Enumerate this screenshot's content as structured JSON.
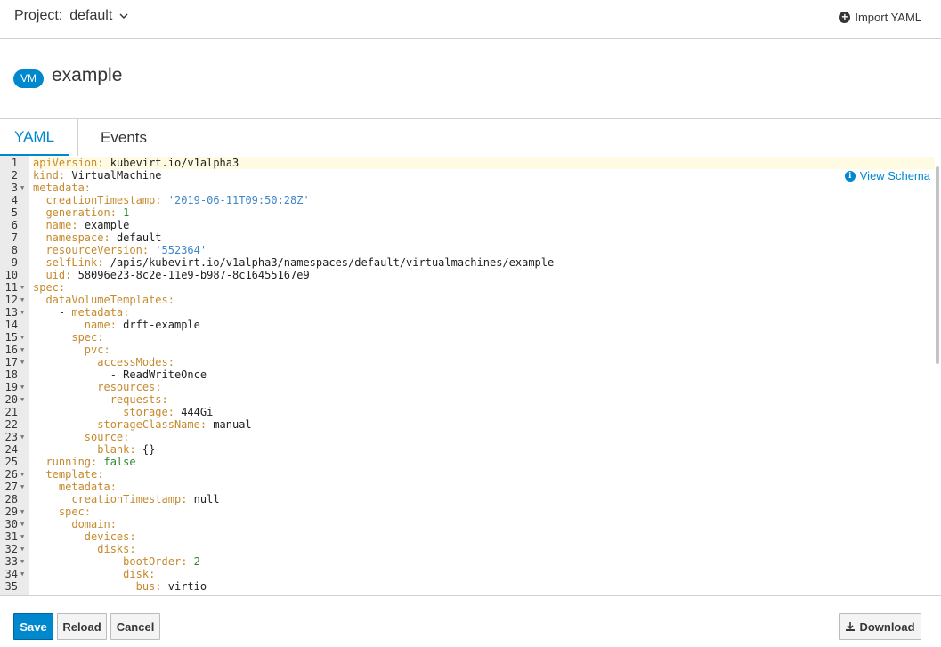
{
  "header": {
    "project_label": "Project:",
    "project_value": "default",
    "import_label": "Import YAML"
  },
  "title": {
    "badge": "VM",
    "name": "example"
  },
  "tabs": [
    {
      "label": "YAML",
      "active": true
    },
    {
      "label": "Events",
      "active": false
    }
  ],
  "editor": {
    "view_schema_label": "View Schema",
    "lines": [
      {
        "n": "1",
        "fold": false,
        "indent": 0,
        "key": "apiVersion",
        "val": "kubevirt.io/v1alpha3",
        "type": "plain"
      },
      {
        "n": "2",
        "fold": false,
        "indent": 0,
        "key": "kind",
        "val": "VirtualMachine",
        "type": "plain"
      },
      {
        "n": "3",
        "fold": true,
        "indent": 0,
        "key": "metadata",
        "val": "",
        "type": "none"
      },
      {
        "n": "4",
        "fold": false,
        "indent": 1,
        "key": "creationTimestamp",
        "val": "'2019-06-11T09:50:28Z'",
        "type": "string"
      },
      {
        "n": "5",
        "fold": false,
        "indent": 1,
        "key": "generation",
        "val": "1",
        "type": "number"
      },
      {
        "n": "6",
        "fold": false,
        "indent": 1,
        "key": "name",
        "val": "example",
        "type": "plain"
      },
      {
        "n": "7",
        "fold": false,
        "indent": 1,
        "key": "namespace",
        "val": "default",
        "type": "plain"
      },
      {
        "n": "8",
        "fold": false,
        "indent": 1,
        "key": "resourceVersion",
        "val": "'552364'",
        "type": "string"
      },
      {
        "n": "9",
        "fold": false,
        "indent": 1,
        "key": "selfLink",
        "val": "/apis/kubevirt.io/v1alpha3/namespaces/default/virtualmachines/example",
        "type": "plain"
      },
      {
        "n": "10",
        "fold": false,
        "indent": 1,
        "key": "uid",
        "val": "58096e23-8c2e-11e9-b987-8c16455167e9",
        "type": "plain"
      },
      {
        "n": "11",
        "fold": true,
        "indent": 0,
        "key": "spec",
        "val": "",
        "type": "none"
      },
      {
        "n": "12",
        "fold": true,
        "indent": 1,
        "key": "dataVolumeTemplates",
        "val": "",
        "type": "none"
      },
      {
        "n": "13",
        "fold": true,
        "indent": 2,
        "dash": true,
        "key": "metadata",
        "val": "",
        "type": "none"
      },
      {
        "n": "14",
        "fold": false,
        "indent": 4,
        "key": "name",
        "val": "drft-example",
        "type": "plain"
      },
      {
        "n": "15",
        "fold": true,
        "indent": 3,
        "key": "spec",
        "val": "",
        "type": "none"
      },
      {
        "n": "16",
        "fold": true,
        "indent": 4,
        "key": "pvc",
        "val": "",
        "type": "none"
      },
      {
        "n": "17",
        "fold": true,
        "indent": 5,
        "key": "accessModes",
        "val": "",
        "type": "none"
      },
      {
        "n": "18",
        "fold": false,
        "indent": 6,
        "dash": true,
        "key": "",
        "val": "ReadWriteOnce",
        "type": "plain"
      },
      {
        "n": "19",
        "fold": true,
        "indent": 5,
        "key": "resources",
        "val": "",
        "type": "none"
      },
      {
        "n": "20",
        "fold": true,
        "indent": 6,
        "key": "requests",
        "val": "",
        "type": "none"
      },
      {
        "n": "21",
        "fold": false,
        "indent": 7,
        "key": "storage",
        "val": "444Gi",
        "type": "plain"
      },
      {
        "n": "22",
        "fold": false,
        "indent": 5,
        "key": "storageClassName",
        "val": "manual",
        "type": "plain"
      },
      {
        "n": "23",
        "fold": true,
        "indent": 4,
        "key": "source",
        "val": "",
        "type": "none"
      },
      {
        "n": "24",
        "fold": false,
        "indent": 5,
        "key": "blank",
        "val": "{}",
        "type": "plain"
      },
      {
        "n": "25",
        "fold": false,
        "indent": 1,
        "key": "running",
        "val": "false",
        "type": "keyword"
      },
      {
        "n": "26",
        "fold": true,
        "indent": 1,
        "key": "template",
        "val": "",
        "type": "none"
      },
      {
        "n": "27",
        "fold": true,
        "indent": 2,
        "key": "metadata",
        "val": "",
        "type": "none"
      },
      {
        "n": "28",
        "fold": false,
        "indent": 3,
        "key": "creationTimestamp",
        "val": "null",
        "type": "plain"
      },
      {
        "n": "29",
        "fold": true,
        "indent": 2,
        "key": "spec",
        "val": "",
        "type": "none"
      },
      {
        "n": "30",
        "fold": true,
        "indent": 3,
        "key": "domain",
        "val": "",
        "type": "none"
      },
      {
        "n": "31",
        "fold": true,
        "indent": 4,
        "key": "devices",
        "val": "",
        "type": "none"
      },
      {
        "n": "32",
        "fold": true,
        "indent": 5,
        "key": "disks",
        "val": "",
        "type": "none"
      },
      {
        "n": "33",
        "fold": true,
        "indent": 6,
        "dash": true,
        "key": "bootOrder",
        "val": "2",
        "type": "number"
      },
      {
        "n": "34",
        "fold": true,
        "indent": 7,
        "key": "disk",
        "val": "",
        "type": "none"
      },
      {
        "n": "35",
        "fold": false,
        "indent": 8,
        "key": "bus",
        "val": "virtio",
        "type": "plain"
      }
    ]
  },
  "footer": {
    "save_label": "Save",
    "reload_label": "Reload",
    "cancel_label": "Cancel",
    "download_label": "Download"
  },
  "colors": {
    "accent": "#0088ce",
    "yaml_key": "#c58a2d",
    "yaml_string": "#3f86c9",
    "yaml_number": "#2a8a2a"
  }
}
